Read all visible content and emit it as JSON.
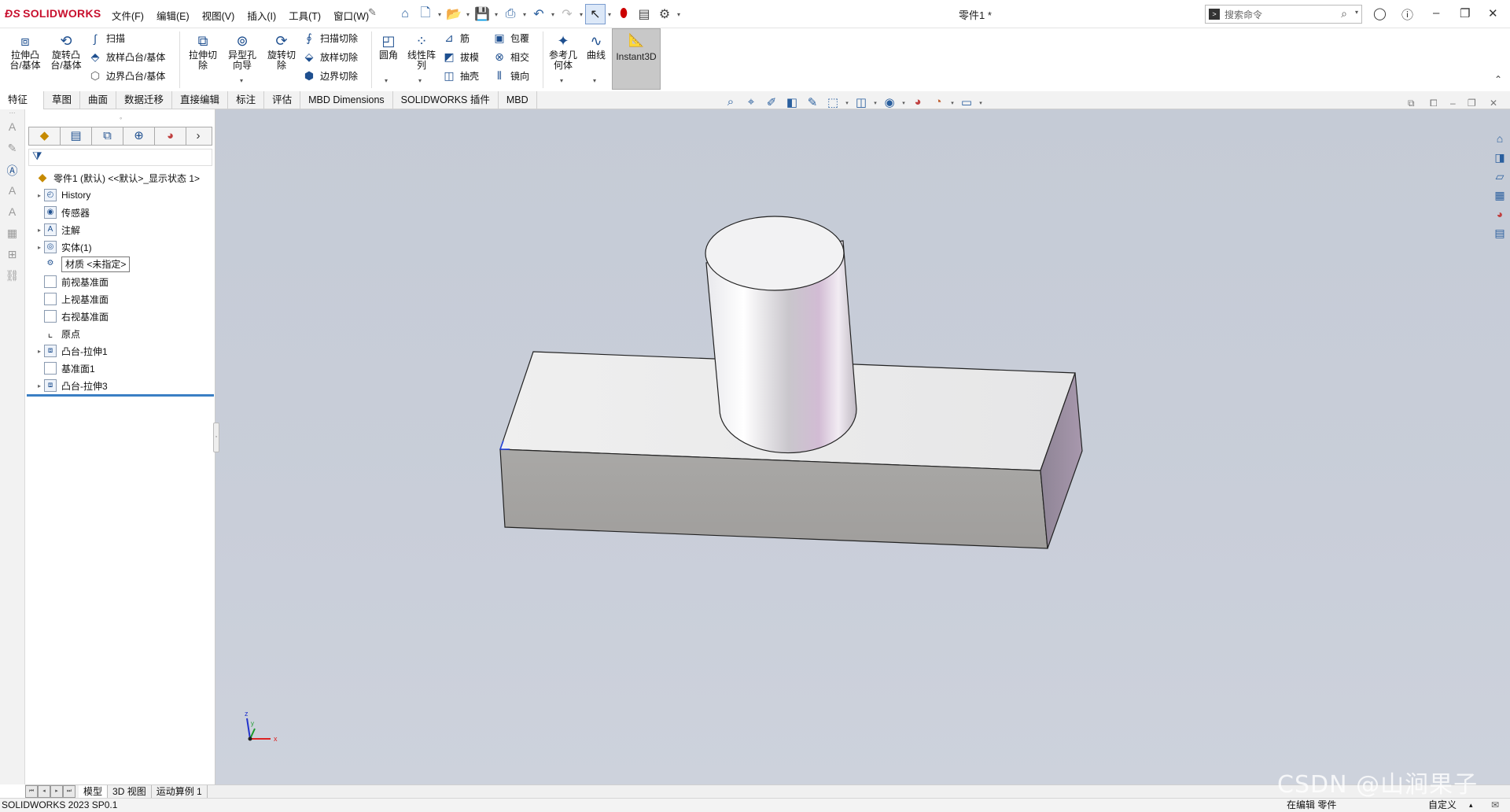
{
  "app": {
    "brand": "SOLIDWORKS",
    "doc_title": "零件1 *"
  },
  "menu": [
    "文件(F)",
    "编辑(E)",
    "视图(V)",
    "插入(I)",
    "工具(T)",
    "窗口(W)"
  ],
  "search": {
    "placeholder": "搜索命令"
  },
  "ribbon": {
    "extrude_boss": "拉伸凸\n台/基体",
    "revolve_boss": "旋转凸\n台/基体",
    "sweep": "扫描",
    "loft": "放样凸台/基体",
    "boundary_boss": "边界凸台/基体",
    "extrude_cut": "拉伸切\n除",
    "hole_wizard": "异型孔\n向导",
    "revolve_cut": "旋转切\n除",
    "sweep_cut": "扫描切除",
    "loft_cut": "放样切除",
    "boundary_cut": "边界切除",
    "fillet": "圆角",
    "linear_pattern": "线性阵\n列",
    "rib": "筋",
    "draft": "拔模",
    "shell": "抽壳",
    "wrap": "包覆",
    "intersect": "相交",
    "mirror": "镜向",
    "ref_geometry": "参考几\n何体",
    "curves": "曲线",
    "instant3d": "Instant3D"
  },
  "tabs": [
    "特征",
    "草图",
    "曲面",
    "数据迁移",
    "直接编辑",
    "标注",
    "评估",
    "MBD Dimensions",
    "SOLIDWORKS 插件",
    "MBD"
  ],
  "tree": {
    "root": "零件1 (默认) <<默认>_显示状态 1>",
    "items": [
      {
        "label": "History",
        "expandable": true,
        "icon": "history-icon"
      },
      {
        "label": "传感器",
        "expandable": false,
        "icon": "sensor-icon"
      },
      {
        "label": "注解",
        "expandable": true,
        "icon": "annotation-icon"
      },
      {
        "label": "实体(1)",
        "expandable": true,
        "icon": "solid-body-icon"
      },
      {
        "label": "材质 <未指定>",
        "expandable": false,
        "icon": "material-icon"
      },
      {
        "label": "前视基准面",
        "expandable": false,
        "icon": "plane-icon"
      },
      {
        "label": "上视基准面",
        "expandable": false,
        "icon": "plane-icon"
      },
      {
        "label": "右视基准面",
        "expandable": false,
        "icon": "plane-icon"
      },
      {
        "label": "原点",
        "expandable": false,
        "icon": "origin-icon"
      },
      {
        "label": "凸台-拉伸1",
        "expandable": true,
        "icon": "extrude-icon"
      },
      {
        "label": "基准面1",
        "expandable": false,
        "icon": "plane-icon"
      },
      {
        "label": "凸台-拉伸3",
        "expandable": true,
        "icon": "extrude-icon"
      }
    ]
  },
  "bottom_tabs": [
    "模型",
    "3D 视图",
    "运动算例 1"
  ],
  "status": {
    "version": "SOLIDWORKS 2023 SP0.1",
    "mode": "在编辑 零件",
    "units": "自定义"
  },
  "triad": {
    "x": "x",
    "y": "y",
    "z": "z"
  },
  "watermark": "CSDN @山涧果子",
  "colors": {
    "accent": "#c8102e",
    "viewport_bg": "#c8cdd8",
    "rollback_bar": "#3b7fc4"
  }
}
